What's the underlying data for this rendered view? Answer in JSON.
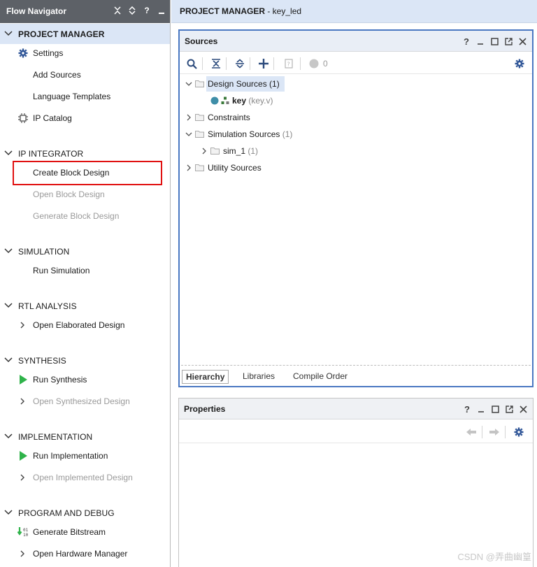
{
  "flow_navigator": {
    "title": "Flow Navigator",
    "sections": [
      {
        "label": "PROJECT MANAGER"
      },
      {
        "label": "IP INTEGRATOR"
      },
      {
        "label": "SIMULATION"
      },
      {
        "label": "RTL ANALYSIS"
      },
      {
        "label": "SYNTHESIS"
      },
      {
        "label": "IMPLEMENTATION"
      },
      {
        "label": "PROGRAM AND DEBUG"
      }
    ],
    "items": {
      "settings": "Settings",
      "add_sources": "Add Sources",
      "language_templates": "Language Templates",
      "ip_catalog": "IP Catalog",
      "create_block_design": "Create Block Design",
      "open_block_design": "Open Block Design",
      "generate_block_design": "Generate Block Design",
      "run_simulation": "Run Simulation",
      "open_elaborated_design": "Open Elaborated Design",
      "run_synthesis": "Run Synthesis",
      "open_synthesized_design": "Open Synthesized Design",
      "run_implementation": "Run Implementation",
      "open_implemented_design": "Open Implemented Design",
      "generate_bitstream": "Generate Bitstream",
      "open_hardware_manager": "Open Hardware Manager"
    }
  },
  "header": {
    "title": "PROJECT MANAGER",
    "project": " - key_led"
  },
  "sources": {
    "title": "Sources",
    "error_count": "0",
    "tree": {
      "design_sources": "Design Sources",
      "design_sources_count": " (1)",
      "key": "key",
      "key_file": " (key.v)",
      "constraints": "Constraints",
      "simulation_sources": "Simulation Sources",
      "simulation_sources_count": " (1)",
      "sim_1": "sim_1",
      "sim_1_count": " (1)",
      "utility_sources": "Utility Sources"
    },
    "tabs": [
      "Hierarchy",
      "Libraries",
      "Compile Order"
    ]
  },
  "properties": {
    "title": "Properties"
  },
  "watermark": "CSDN @弄曲幽篁",
  "colors": {
    "nav_header": "#5d6167",
    "active_bg": "#dbe6f6",
    "panel_border": "#4a78c2",
    "run_green": "#2fb34a",
    "highlight_red": "#e01010"
  }
}
